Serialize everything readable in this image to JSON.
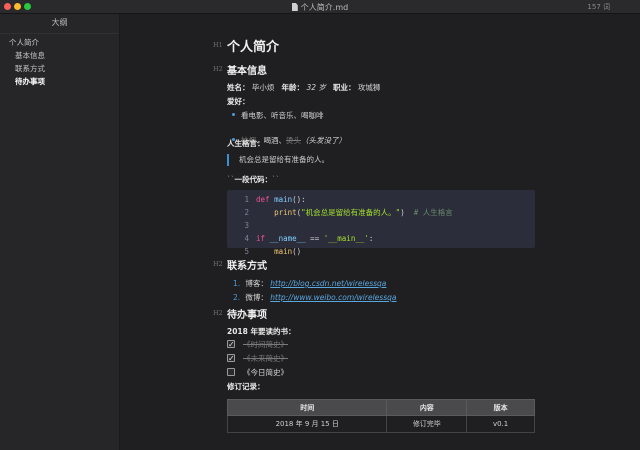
{
  "window": {
    "title": "个人简介.md",
    "word_count": "157 词",
    "colors": {
      "close": "#fc5f57",
      "minimize": "#fdbc2e",
      "maximize": "#28c840",
      "accent": "#3b8fd0"
    }
  },
  "sidebar": {
    "title": "大纲",
    "items": [
      {
        "label": "个人简介",
        "level": 1
      },
      {
        "label": "基本信息",
        "level": 2
      },
      {
        "label": "联系方式",
        "level": 2
      },
      {
        "label": "待办事项",
        "level": 2,
        "active": true
      }
    ]
  },
  "doc": {
    "h1": "个人简介",
    "heading_marker": "H1",
    "heading_marker2": "H2",
    "basic": {
      "title": "基本信息",
      "name_label": "姓名",
      "name_value": "毕小烦",
      "age_label": "年龄",
      "age_value": "32 岁",
      "job_label": "职业",
      "job_value": "攻城狮",
      "hobby_label": "爱好",
      "hobby_1": "看电影、听音乐、喝咖啡",
      "hobby_2_strike_a": "抽烟",
      "hobby_2_mid": "、喝酒、",
      "hobby_2_strike_b": "烫头",
      "hobby_2_note": "（头发没了）",
      "motto_label": "人生格言",
      "motto": "机会总是留给有准备的人。",
      "code_label": "一段代码",
      "code_prefix": "``",
      "code_suffix": "``",
      "code": [
        {
          "n": "1"
        },
        {
          "n": "2"
        },
        {
          "n": "3"
        },
        {
          "n": "4"
        },
        {
          "n": "5"
        }
      ],
      "code_tokens": {
        "def": "def",
        "main": "main",
        "paren_colon": "():",
        "print": "print",
        "print_open": "(",
        "print_str": "\"机会总是留给有准备的人。\"",
        "print_close": ")",
        "comment": "# 人生格言",
        "if": "if",
        "dunder_name": "__name__",
        "eq": " == ",
        "main_str": "'__main__'",
        "colon": ":",
        "call": "main",
        "call_paren": "()"
      }
    },
    "contact": {
      "title": "联系方式",
      "items": [
        {
          "num": "1.",
          "label": "博客：",
          "url": "http://blog.csdn.net/wirelessqa"
        },
        {
          "num": "2.",
          "label": "微博：",
          "url": "http://www.weibo.com/wirelessqa"
        }
      ]
    },
    "todo": {
      "title": "待办事项",
      "books_label": "2018 年要读的书",
      "books": [
        {
          "title": "《时间简史》",
          "done": true
        },
        {
          "title": "《未来简史》",
          "done": true
        },
        {
          "title": "《今日简史》",
          "done": false
        }
      ],
      "revision_label": "修订记录",
      "table": {
        "headers": [
          "时间",
          "内容",
          "版本"
        ],
        "rows": [
          [
            "2018 年 9 月 15 日",
            "修订完毕",
            "v0.1"
          ]
        ]
      }
    }
  }
}
